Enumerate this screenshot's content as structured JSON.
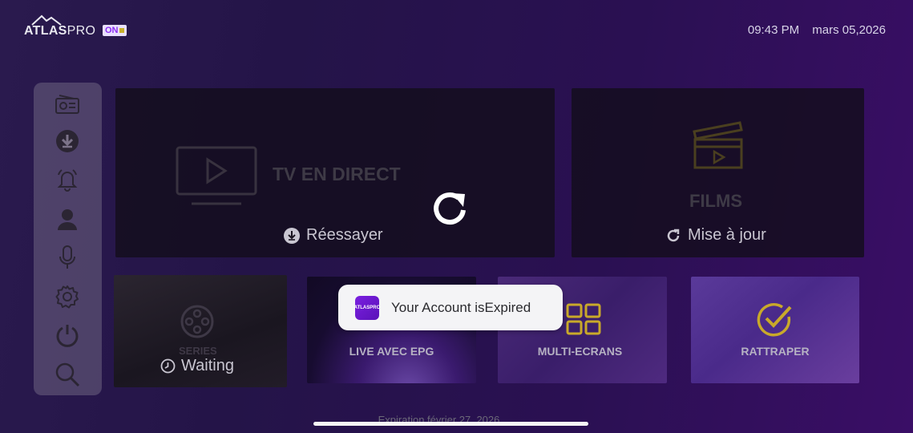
{
  "header": {
    "logo_main": "ATLAS",
    "logo_pro": "PRO",
    "logo_badge": "ON",
    "time": "09:43 PM",
    "date": "mars 05,2026"
  },
  "sidebar": {
    "items": [
      {
        "icon": "radio-icon"
      },
      {
        "icon": "download-icon"
      },
      {
        "icon": "bell-icon"
      },
      {
        "icon": "user-icon"
      },
      {
        "icon": "microphone-icon"
      },
      {
        "icon": "gear-icon"
      },
      {
        "icon": "power-icon"
      },
      {
        "icon": "search-icon"
      }
    ]
  },
  "tiles": {
    "live_tv": {
      "label": "TV EN DIRECT",
      "status": "Réessayer"
    },
    "films": {
      "label": "FILMS",
      "status": "Mise à jour"
    },
    "series": {
      "label": "SERIES",
      "status": "Waiting"
    },
    "live_epg": {
      "label": "LIVE AVEC EPG"
    },
    "multi_screen": {
      "label": "MULTI-ECRANS"
    },
    "catchup": {
      "label": "RATTRAPER"
    }
  },
  "toast": {
    "message": "Your Account isExpired",
    "icon_text": "ATLASPRO"
  },
  "footer": {
    "expiration": "Expiration  février 27, 2026"
  },
  "colors": {
    "accent_gold": "#c9a92a",
    "brand_purple": "#7a1fe0"
  }
}
